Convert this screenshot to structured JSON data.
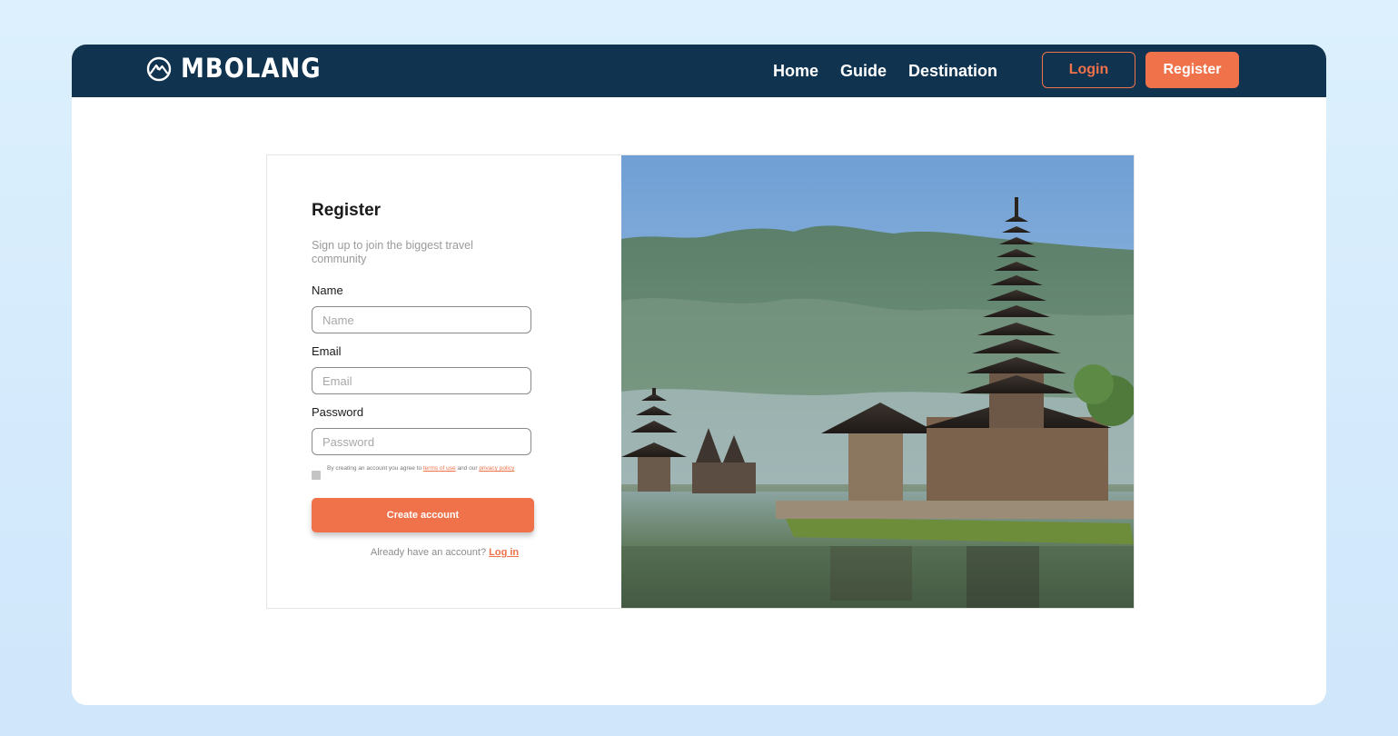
{
  "brand": {
    "name": "MBOLANG",
    "icon": "mountain-logo-icon"
  },
  "nav": {
    "links": [
      "Home",
      "Guide",
      "Destination"
    ],
    "login_label": "Login",
    "register_label": "Register"
  },
  "form": {
    "title": "Register",
    "subtitle": "Sign up to join the biggest travel community",
    "name_label": "Name",
    "name_placeholder": "Name",
    "email_label": "Email",
    "email_placeholder": "Email",
    "password_label": "Password",
    "password_placeholder": "Password",
    "terms_prefix": "By creating an account you agree to ",
    "terms_link": "terms of use",
    "terms_middle": " and our ",
    "privacy_link": "privacy policy",
    "terms_checked": false,
    "submit_label": "Create account",
    "login_prompt": "Already have an account? ",
    "login_link": "Log in"
  },
  "hero_image": {
    "subject": "temple-on-lake-with-mountains"
  },
  "colors": {
    "navy": "#10334f",
    "accent": "#ef724b",
    "background": "#d8eefc"
  }
}
